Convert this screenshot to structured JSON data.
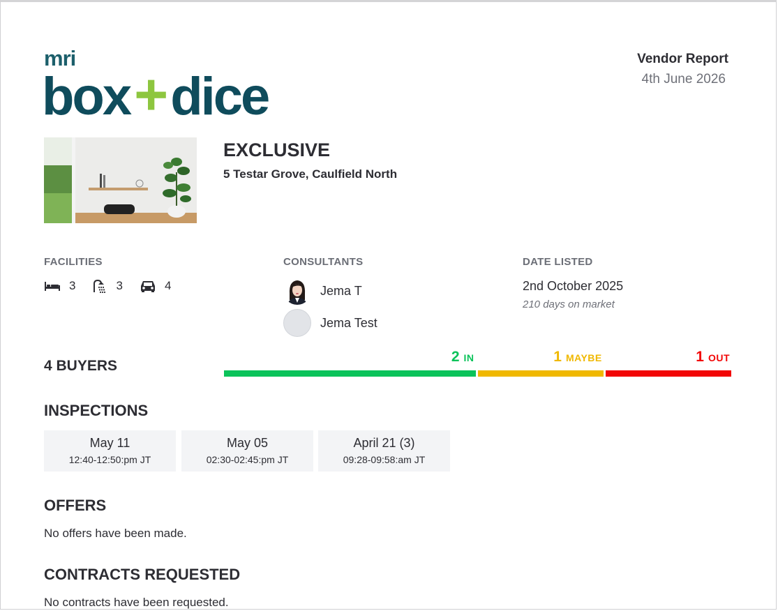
{
  "logo": {
    "mri": "mri",
    "main_left": "box",
    "plus": "+",
    "main_right": "dice"
  },
  "report": {
    "title": "Vendor Report",
    "date": "4th June 2026"
  },
  "property": {
    "type": "EXCLUSIVE",
    "address": "5 Testar Grove, Caulfield North"
  },
  "facilities": {
    "label": "FACILITIES",
    "items": [
      {
        "icon": "bed-icon",
        "value": "3"
      },
      {
        "icon": "shower-icon",
        "value": "3"
      },
      {
        "icon": "car-icon",
        "value": "4"
      }
    ]
  },
  "consultants": {
    "label": "CONSULTANTS",
    "items": [
      {
        "name": "Jema T"
      },
      {
        "name": "Jema Test"
      }
    ]
  },
  "date_listed": {
    "label": "DATE LISTED",
    "date": "2nd October 2025",
    "days": "210 days on market"
  },
  "buyers": {
    "count_label": "4 BUYERS",
    "in": {
      "count": 2,
      "word": "IN",
      "color": "#0bc35a"
    },
    "maybe": {
      "count": 1,
      "word": "MAYBE",
      "color": "#f0b800"
    },
    "out": {
      "count": 1,
      "word": "OUT",
      "color": "#f20606"
    }
  },
  "inspections": {
    "title": "INSPECTIONS",
    "items": [
      {
        "date": "May 11",
        "time": "12:40-12:50:pm JT"
      },
      {
        "date": "May 05",
        "time": "02:30-02:45:pm JT"
      },
      {
        "date": "April 21 (3)",
        "time": "09:28-09:58:am JT"
      }
    ]
  },
  "offers": {
    "title": "OFFERS",
    "text": "No offers have been made."
  },
  "contracts": {
    "title": "CONTRACTS REQUESTED",
    "text": "No contracts have been requested."
  }
}
